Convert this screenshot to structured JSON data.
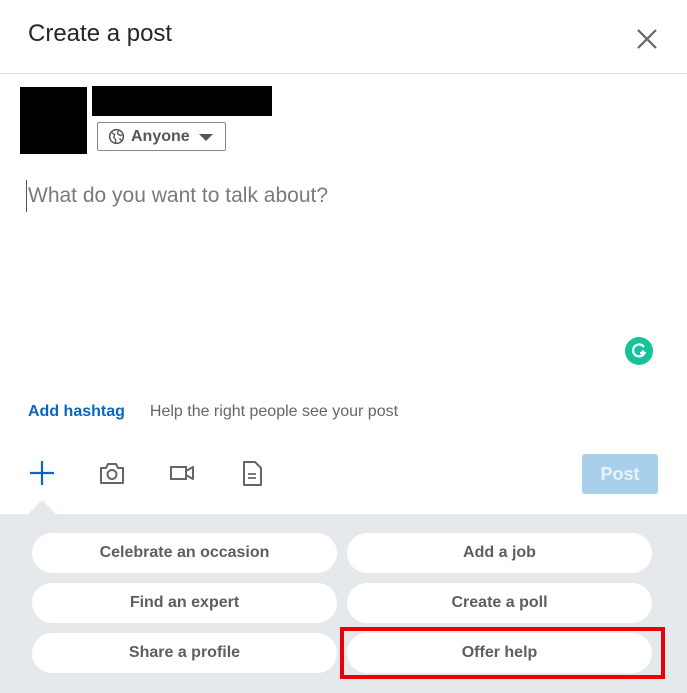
{
  "dialog": {
    "title": "Create a post",
    "close_icon": "close-icon"
  },
  "author": {
    "avatar": "redacted",
    "name": "redacted",
    "audience": {
      "icon": "globe-icon",
      "label": "Anyone",
      "caret_icon": "caret-down-icon"
    }
  },
  "editor": {
    "placeholder": "What do you want to talk about?",
    "value": ""
  },
  "grammarly": {
    "icon": "grammarly-icon",
    "color": "#15c39a"
  },
  "hashtag": {
    "link_label": "Add hashtag",
    "hint": "Help the right people see your post"
  },
  "toolbar": {
    "icons": [
      "plus-icon",
      "camera-icon",
      "video-icon",
      "document-icon"
    ],
    "post_label": "Post",
    "post_enabled": false
  },
  "tray": {
    "options": [
      {
        "label": "Celebrate an occasion"
      },
      {
        "label": "Add a job"
      },
      {
        "label": "Find an expert"
      },
      {
        "label": "Create a poll"
      },
      {
        "label": "Share a profile"
      },
      {
        "label": "Offer help",
        "highlighted": true
      }
    ]
  },
  "colors": {
    "accent": "#0a66c2",
    "post_disabled_bg": "#a9d0ea",
    "tray_bg": "#e6e9ec",
    "highlight": "#e8000b"
  }
}
